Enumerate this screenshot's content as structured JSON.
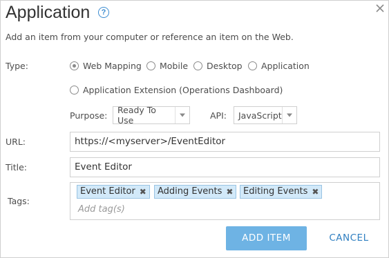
{
  "dialog": {
    "title": "Application",
    "description": "Add an item from your computer or reference an item on the Web."
  },
  "type": {
    "label": "Type:",
    "options": [
      {
        "label": "Web Mapping",
        "checked": true
      },
      {
        "label": "Mobile",
        "checked": false
      },
      {
        "label": "Desktop",
        "checked": false
      },
      {
        "label": "Application",
        "checked": false
      },
      {
        "label": "Application Extension (Operations Dashboard)",
        "checked": false
      }
    ]
  },
  "purpose": {
    "label": "Purpose:",
    "value": "Ready To Use"
  },
  "api": {
    "label": "API:",
    "value": "JavaScript"
  },
  "url": {
    "label": "URL:",
    "value": "https://<myserver>/EventEditor"
  },
  "title_field": {
    "label": "Title:",
    "value": "Event Editor"
  },
  "tags": {
    "label": "Tags:",
    "items": [
      "Event Editor",
      "Adding Events",
      "Editing Events"
    ],
    "remove_glyph": "✖",
    "placeholder": "Add tag(s)"
  },
  "buttons": {
    "add_label": "ADD ITEM",
    "cancel_label": "CANCEL"
  },
  "help_glyph": "?",
  "icons": {
    "help": "question-circle-icon",
    "close": "close-icon",
    "dropdown": "chevron-down-icon",
    "tag_remove": "remove-tag-icon"
  },
  "colors": {
    "accent": "#6eb3e4",
    "link": "#2f7fc1",
    "tag_bg": "#d2e9f9",
    "tag_border": "#99c3e3"
  }
}
